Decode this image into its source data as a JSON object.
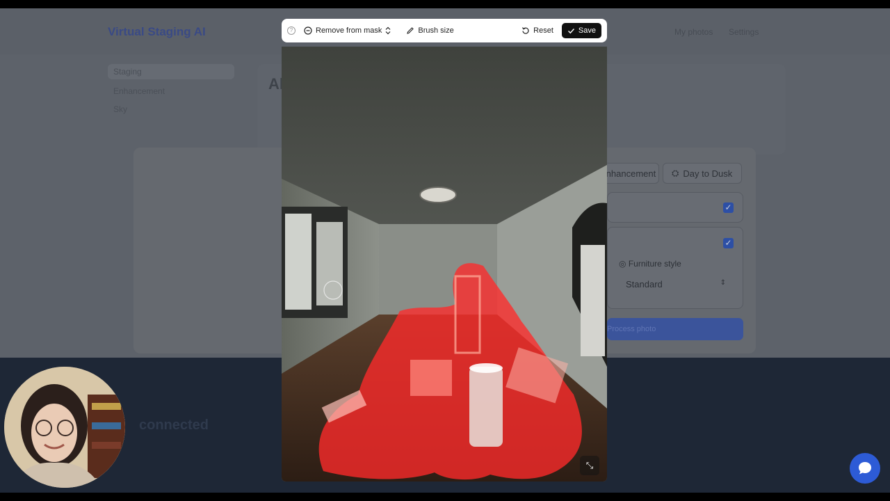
{
  "background_app": {
    "logo": "Virtual Staging AI",
    "nav": [
      "My photos",
      "Settings"
    ],
    "sidebar": [
      "Staging",
      "Enhancement",
      "Sky"
    ],
    "page_title": "All",
    "tabs": [
      "Enhancement",
      "Day to Dusk"
    ],
    "furniture_style_label": "Furniture style",
    "furniture_style_value": "Standard",
    "process_button": "Process photo",
    "footer_heading": "connected"
  },
  "toolbar": {
    "mode_label": "Remove from mask",
    "brush_label": "Brush size",
    "reset_label": "Reset",
    "save_label": "Save"
  },
  "icons": {
    "help": "help-icon",
    "mode": "minus-circle-icon",
    "mode_toggle": "chevron-updown-icon",
    "brush": "pencil-icon",
    "reset": "reset-icon",
    "save": "check-icon",
    "collapse": "collapse-icon",
    "chat": "chat-bubble-icon"
  },
  "colors": {
    "mask": "#ff2a2a",
    "save_bg": "#111111",
    "chat_bg": "#2d5bd6"
  }
}
